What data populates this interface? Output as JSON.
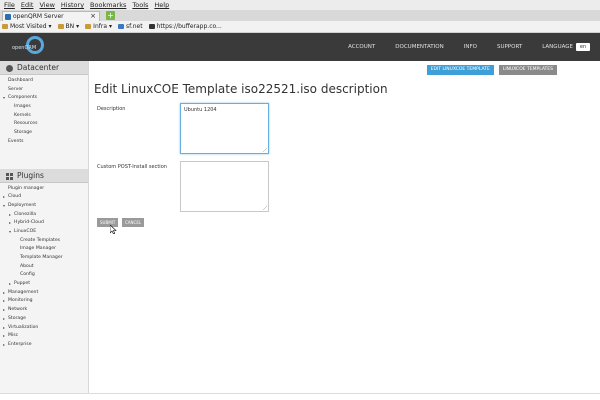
{
  "browser": {
    "menu": [
      "File",
      "Edit",
      "View",
      "History",
      "Bookmarks",
      "Tools",
      "Help"
    ],
    "tab_title": "openQRM Server",
    "new_tab": "+",
    "tab_close": "×",
    "bookmarks": [
      {
        "label": "Most Visited",
        "caret": "▾"
      },
      {
        "label": "BN",
        "caret": "▾"
      },
      {
        "label": "Infra",
        "caret": "▾"
      },
      {
        "label": "sf.net",
        "caret": ""
      },
      {
        "label": "https://bufferapp.co...",
        "caret": ""
      }
    ]
  },
  "header": {
    "logo_text": "openQRM",
    "nav": [
      "ACCOUNT",
      "DOCUMENTATION",
      "INFO",
      "SUPPORT",
      "LANGUAGE"
    ],
    "language_value": "en"
  },
  "sidebar": {
    "datacenter_title": "Datacenter",
    "datacenter_items": [
      {
        "label": "Dashboard",
        "level": 0,
        "arrow": ""
      },
      {
        "label": "Server",
        "level": 0,
        "arrow": ""
      },
      {
        "label": "Components",
        "level": 0,
        "arrow": "▾"
      },
      {
        "label": "Images",
        "level": 1,
        "arrow": ""
      },
      {
        "label": "Kernels",
        "level": 1,
        "arrow": ""
      },
      {
        "label": "Resources",
        "level": 1,
        "arrow": ""
      },
      {
        "label": "Storage",
        "level": 1,
        "arrow": ""
      },
      {
        "label": "Events",
        "level": 0,
        "arrow": ""
      }
    ],
    "plugins_title": "Plugins",
    "plugin_items": [
      {
        "label": "Plugin manager",
        "level": 0,
        "arrow": ""
      },
      {
        "label": "Cloud",
        "level": 0,
        "arrow": "▸"
      },
      {
        "label": "Deployment",
        "level": 0,
        "arrow": "▾"
      },
      {
        "label": "Clonezilla",
        "level": 1,
        "arrow": "▸"
      },
      {
        "label": "Hybrid-Cloud",
        "level": 1,
        "arrow": "▸"
      },
      {
        "label": "LinuxCOE",
        "level": 1,
        "arrow": "▾"
      },
      {
        "label": "Create Templates",
        "level": 2,
        "arrow": ""
      },
      {
        "label": "Image Manager",
        "level": 2,
        "arrow": ""
      },
      {
        "label": "Template Manager",
        "level": 2,
        "arrow": ""
      },
      {
        "label": "About",
        "level": 2,
        "arrow": ""
      },
      {
        "label": "Config",
        "level": 2,
        "arrow": ""
      },
      {
        "label": "Puppet",
        "level": 1,
        "arrow": "▸"
      },
      {
        "label": "Management",
        "level": 0,
        "arrow": "▸"
      },
      {
        "label": "Monitoring",
        "level": 0,
        "arrow": "▸"
      },
      {
        "label": "Network",
        "level": 0,
        "arrow": "▸"
      },
      {
        "label": "Storage",
        "level": 0,
        "arrow": "▸"
      },
      {
        "label": "Virtualization",
        "level": 0,
        "arrow": "▸"
      },
      {
        "label": "Misc",
        "level": 0,
        "arrow": "▸"
      },
      {
        "label": "Enterprise",
        "level": 0,
        "arrow": "▸"
      }
    ]
  },
  "main": {
    "edit_button": "EDIT LINUXCOE TEMPLATE",
    "templates_button": "LINUXCOE TEMPLATES",
    "page_title": "Edit LinuxCOE Template iso22521.iso description",
    "description_label": "Description",
    "description_value": "Ubuntu 1204",
    "post_install_label": "Custom POST-Install section",
    "post_install_value": "",
    "submit_label": "SUBMIT",
    "cancel_label": "CANCEL"
  },
  "colors": {
    "header_bg": "#3a3a3a",
    "accent": "#3ea0d8",
    "button_gray": "#8a8a8a"
  }
}
